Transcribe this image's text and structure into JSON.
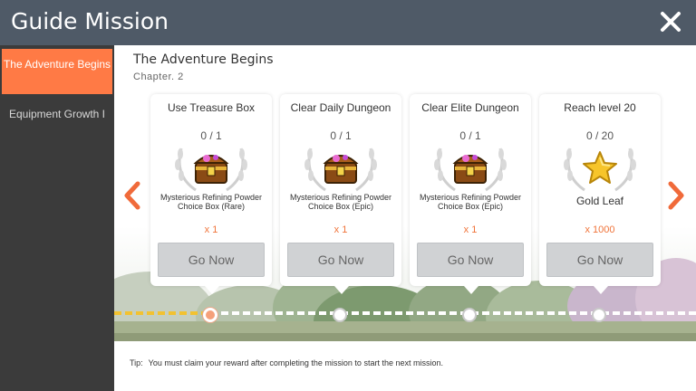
{
  "window": {
    "title": "Guide Mission",
    "close_icon": "close-icon"
  },
  "sidebar": {
    "items": [
      {
        "label": "The Adventure Begins",
        "active": true
      },
      {
        "label": "Equipment Growth I",
        "active": false
      }
    ]
  },
  "chapter": {
    "title": "The Adventure Begins",
    "subtitle": "Chapter. 2"
  },
  "missions": [
    {
      "title": "Use Treasure Box",
      "progress": "0 / 1",
      "reward_icon": "treasure-chest-icon",
      "reward": "Mysterious Refining Powder Choice Box (Rare)",
      "quantity": "x 1",
      "button": "Go Now"
    },
    {
      "title": "Clear Daily Dungeon",
      "progress": "0 / 1",
      "reward_icon": "treasure-chest-icon",
      "reward": "Mysterious Refining Powder Choice Box (Epic)",
      "quantity": "x 1",
      "button": "Go Now"
    },
    {
      "title": "Clear Elite Dungeon",
      "progress": "0 / 1",
      "reward_icon": "treasure-chest-icon",
      "reward": "Mysterious Refining Powder Choice Box (Epic)",
      "quantity": "x 1",
      "button": "Go Now"
    },
    {
      "title": "Reach level 20",
      "progress": "0 / 20",
      "reward_icon": "gold-leaf-icon",
      "reward": "Gold Leaf",
      "quantity": "x 1000",
      "button": "Go Now"
    }
  ],
  "tip": {
    "label": "Tip:",
    "text": "You must claim your reward after completing the mission to start the next mission."
  },
  "colors": {
    "header": "#4f5a67",
    "sidebar": "#3b3b3b",
    "accent": "#ff7a45",
    "button": "#d0d2d4"
  }
}
